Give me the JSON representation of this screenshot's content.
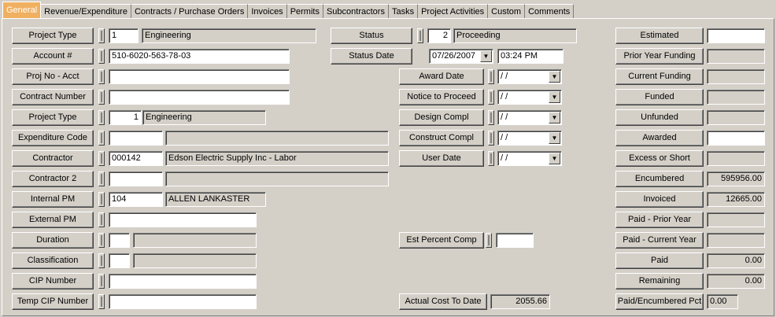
{
  "tabs": [
    "General",
    "Revenue/Expenditure",
    "Contracts / Purchase Orders",
    "Invoices",
    "Permits",
    "Subcontractors",
    "Tasks",
    "Project Activities",
    "Custom",
    "Comments"
  ],
  "left": {
    "project_type": {
      "label": "Project Type",
      "code": "1",
      "desc": "Engineering"
    },
    "account": {
      "label": "Account #",
      "value": "510-6020-563-78-03"
    },
    "proj_no_acct": {
      "label": "Proj No - Acct",
      "value": ""
    },
    "contract_number": {
      "label": "Contract Number",
      "value": ""
    },
    "project_type2": {
      "label": "Project Type",
      "code": "1",
      "desc": "Engineering"
    },
    "expenditure_code": {
      "label": "Expenditure Code",
      "code": "",
      "desc": ""
    },
    "contractor": {
      "label": "Contractor",
      "code": "000142",
      "desc": "Edson Electric Supply Inc - Labor"
    },
    "contractor2": {
      "label": "Contractor 2",
      "code": "",
      "desc": ""
    },
    "internal_pm": {
      "label": "Internal PM",
      "code": "104",
      "desc": "ALLEN LANKASTER"
    },
    "external_pm": {
      "label": "External PM",
      "value": ""
    },
    "duration": {
      "label": "Duration",
      "code": "",
      "desc": ""
    },
    "classification": {
      "label": "Classification",
      "code": "",
      "desc": ""
    },
    "cip_number": {
      "label": "CIP Number",
      "value": ""
    },
    "temp_cip_number": {
      "label": "Temp CIP Number",
      "value": ""
    }
  },
  "middle": {
    "status": {
      "label": "Status",
      "code": "2",
      "desc": "Proceeding"
    },
    "status_date": {
      "label": "Status Date",
      "date": "07/26/2007",
      "time": "03:24 PM"
    },
    "award_date": {
      "label": "Award Date",
      "value": " / /"
    },
    "notice_to_proceed": {
      "label": "Notice to Proceed",
      "value": " / /"
    },
    "design_compl": {
      "label": "Design Compl",
      "value": " / /"
    },
    "construct_compl": {
      "label": "Construct Compl",
      "value": " / /"
    },
    "user_date": {
      "label": "User Date",
      "value": " / /"
    },
    "est_percent_comp": {
      "label": "Est Percent Comp",
      "value": ""
    },
    "actual_cost_to_date": {
      "label": "Actual Cost To Date",
      "value": "2055.66"
    }
  },
  "right": {
    "estimated": {
      "label": "Estimated",
      "value": ""
    },
    "prior_year_funding": {
      "label": "Prior Year Funding",
      "value": ""
    },
    "current_funding": {
      "label": "Current Funding",
      "value": ""
    },
    "funded": {
      "label": "Funded",
      "value": ""
    },
    "unfunded": {
      "label": "Unfunded",
      "value": ""
    },
    "awarded": {
      "label": "Awarded",
      "value": ""
    },
    "excess_or_short": {
      "label": "Excess or Short",
      "value": ""
    },
    "encumbered": {
      "label": "Encumbered",
      "value": "595956.00"
    },
    "invoiced": {
      "label": "Invoiced",
      "value": "12665.00"
    },
    "paid_prior_year": {
      "label": "Paid - Prior Year",
      "value": ""
    },
    "paid_current_year": {
      "label": "Paid - Current Year",
      "value": ""
    },
    "paid": {
      "label": "Paid",
      "value": "0.00"
    },
    "remaining": {
      "label": "Remaining",
      "value": "0.00"
    },
    "paid_encumbered_pct": {
      "label": "Paid/Encumbered Pct",
      "value": "0.00"
    }
  }
}
